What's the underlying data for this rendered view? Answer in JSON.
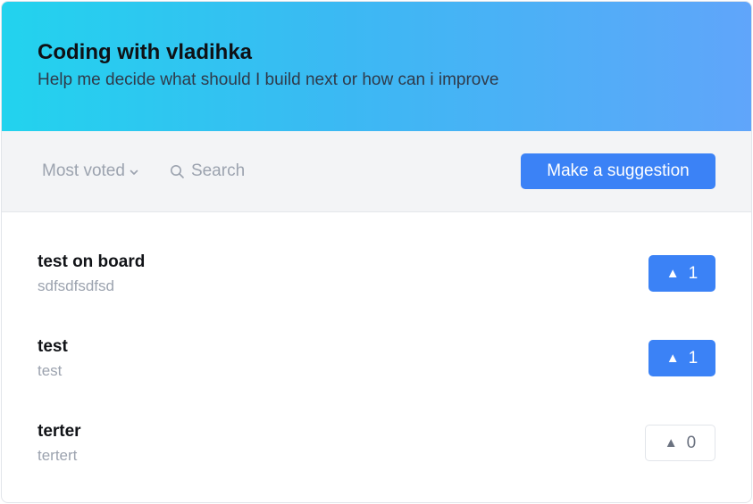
{
  "header": {
    "title": "Coding with vladihka",
    "subtitle": "Help me decide what should I build next or how can i improve"
  },
  "toolbar": {
    "sort_label": "Most voted",
    "search_placeholder": "Search",
    "suggest_label": "Make a suggestion"
  },
  "colors": {
    "accent": "#3b82f6",
    "gradient_start": "#22d3ee",
    "gradient_end": "#60a5fa"
  },
  "suggestions": [
    {
      "title": "test on board",
      "description": "sdfsdfsdfsd",
      "votes": "1",
      "voted": true
    },
    {
      "title": "test",
      "description": "test",
      "votes": "1",
      "voted": true
    },
    {
      "title": "terter",
      "description": "tertert",
      "votes": "0",
      "voted": false
    }
  ],
  "vote_icon": "▲"
}
